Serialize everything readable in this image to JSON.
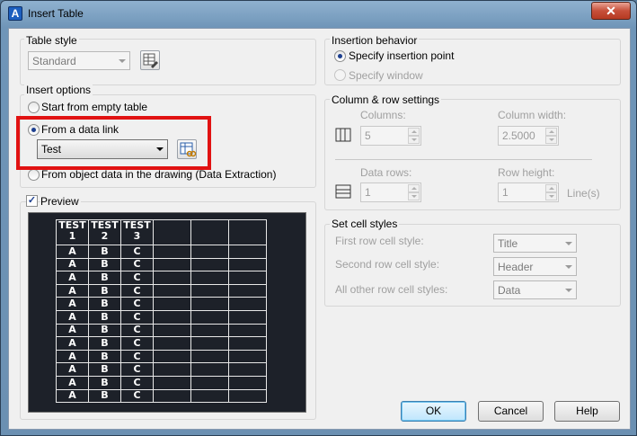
{
  "window": {
    "title": "Insert Table",
    "close_glyph": "✕",
    "app_icon_glyph": "A"
  },
  "table_style": {
    "group_label": "Table style",
    "value": "Standard"
  },
  "insert_options": {
    "group_label": "Insert options",
    "start_empty": "Start from empty table",
    "from_data_link": "From a data link",
    "data_link_value": "Test",
    "from_object_data": "From object data in the drawing (Data Extraction)"
  },
  "preview": {
    "checkbox_label": "Preview",
    "checked": true,
    "header_row": [
      "TEST\n1",
      "TEST 2",
      "TEST 3",
      "",
      "",
      ""
    ],
    "data_rows": [
      [
        "A",
        "B",
        "C",
        "",
        "",
        ""
      ],
      [
        "A",
        "B",
        "C",
        "",
        "",
        ""
      ],
      [
        "A",
        "B",
        "C",
        "",
        "",
        ""
      ],
      [
        "A",
        "B",
        "C",
        "",
        "",
        ""
      ],
      [
        "A",
        "B",
        "C",
        "",
        "",
        ""
      ],
      [
        "A",
        "B",
        "C",
        "",
        "",
        ""
      ],
      [
        "A",
        "B",
        "C",
        "",
        "",
        ""
      ],
      [
        "A",
        "B",
        "C",
        "",
        "",
        ""
      ],
      [
        "A",
        "B",
        "C",
        "",
        "",
        ""
      ],
      [
        "A",
        "B",
        "C",
        "",
        "",
        ""
      ],
      [
        "A",
        "B",
        "C",
        "",
        "",
        ""
      ],
      [
        "A",
        "B",
        "C",
        "",
        "",
        ""
      ]
    ]
  },
  "insertion_behavior": {
    "group_label": "Insertion behavior",
    "specify_point": "Specify insertion point",
    "specify_window": "Specify window"
  },
  "column_row": {
    "group_label": "Column & row settings",
    "columns_label": "Columns:",
    "columns_value": "5",
    "column_width_label": "Column width:",
    "column_width_value": "2.5000",
    "data_rows_label": "Data rows:",
    "data_rows_value": "1",
    "row_height_label": "Row height:",
    "row_height_value": "1",
    "row_height_unit": "Line(s)"
  },
  "cell_styles": {
    "group_label": "Set cell styles",
    "first_row_label": "First row cell style:",
    "first_row_value": "Title",
    "second_row_label": "Second row cell style:",
    "second_row_value": "Header",
    "other_rows_label": "All other row cell styles:",
    "other_rows_value": "Data"
  },
  "buttons": {
    "ok": "OK",
    "cancel": "Cancel",
    "help": "Help"
  },
  "colors": {
    "highlight": "#e11212",
    "preview_bg": "#1d2129"
  }
}
